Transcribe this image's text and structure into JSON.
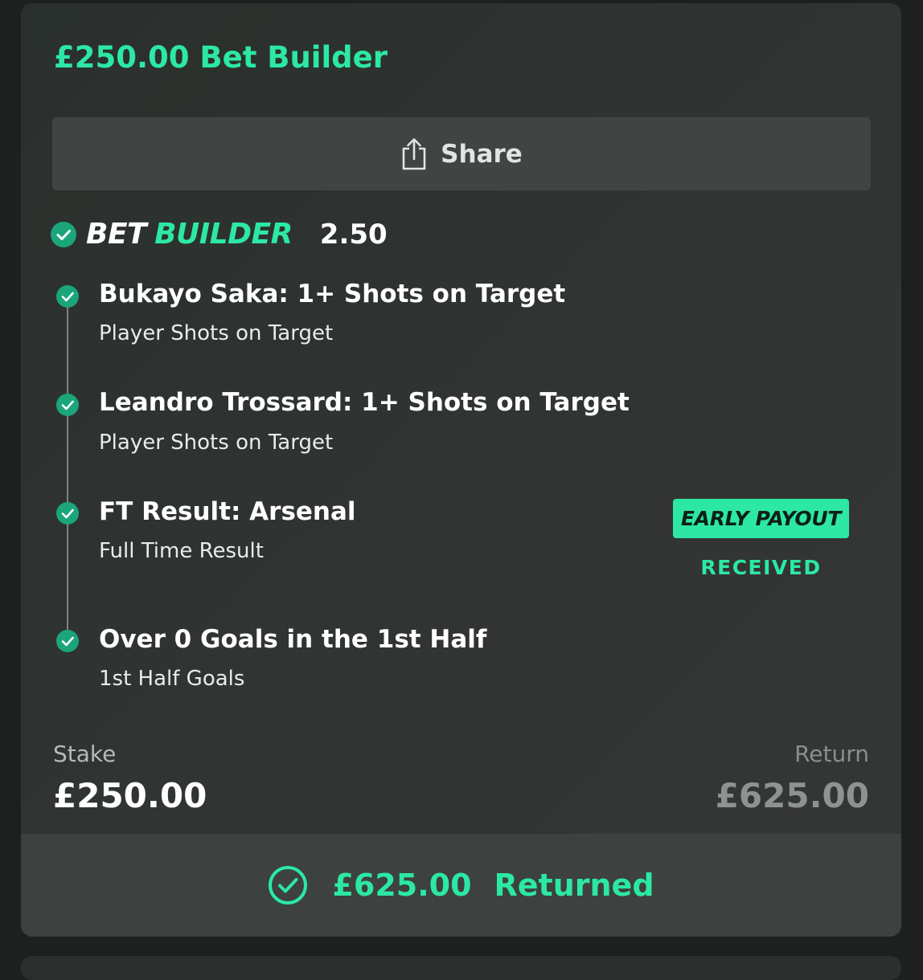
{
  "bet": {
    "title": "£250.00 Bet Builder",
    "share_label": "Share",
    "builder_word1": "BET",
    "builder_word2": "BUILDER",
    "odds": "2.50"
  },
  "legs": [
    {
      "title": "Bukayo Saka: 1+ Shots on Target",
      "subtitle": "Player Shots on Target"
    },
    {
      "title": "Leandro Trossard: 1+ Shots on Target",
      "subtitle": "Player Shots on Target"
    },
    {
      "title": "FT Result: Arsenal",
      "subtitle": "Full Time Result"
    },
    {
      "title": "Over 0 Goals in the 1st Half",
      "subtitle": "1st Half Goals"
    }
  ],
  "early_payout": {
    "badge": "EARLY PAYOUT",
    "status": "RECEIVED"
  },
  "summary": {
    "stake_label": "Stake",
    "stake_value": "£250.00",
    "return_label": "Return",
    "return_value": "£625.00"
  },
  "returned": {
    "amount": "£625.00",
    "label": "Returned"
  },
  "icons": {
    "share": "share-icon",
    "check": "check-circle-icon",
    "returned": "check-circle-outline-icon"
  },
  "colors": {
    "accent": "#2ce8a4",
    "card_bg": "#2f3331",
    "returned_bar": "#3d413f"
  }
}
